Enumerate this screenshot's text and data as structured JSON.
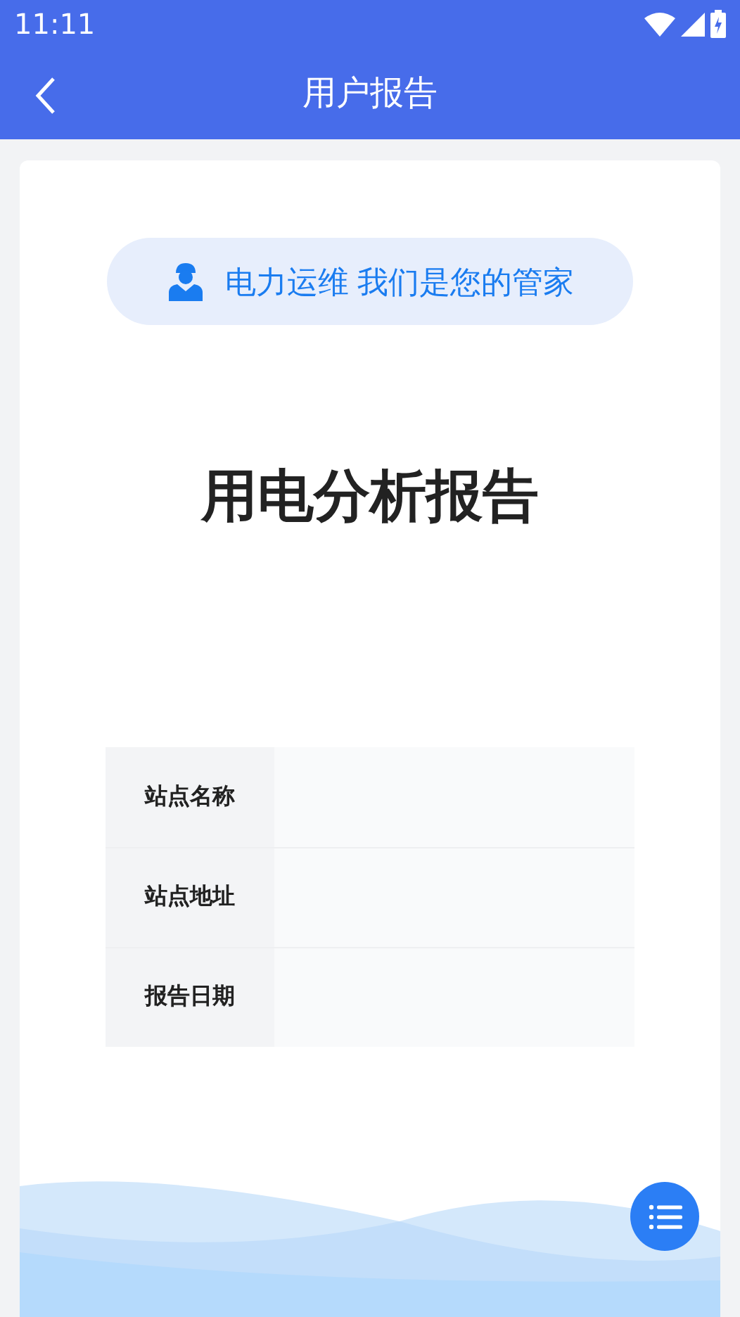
{
  "status_bar": {
    "time": "11:11"
  },
  "nav_bar": {
    "title": "用户报告"
  },
  "slogan": "电力运维 我们是您的管家",
  "report_title": "用电分析报告",
  "info_table": {
    "rows": [
      {
        "label": "站点名称"
      },
      {
        "label": "站点地址"
      },
      {
        "label": "报告日期"
      }
    ]
  }
}
